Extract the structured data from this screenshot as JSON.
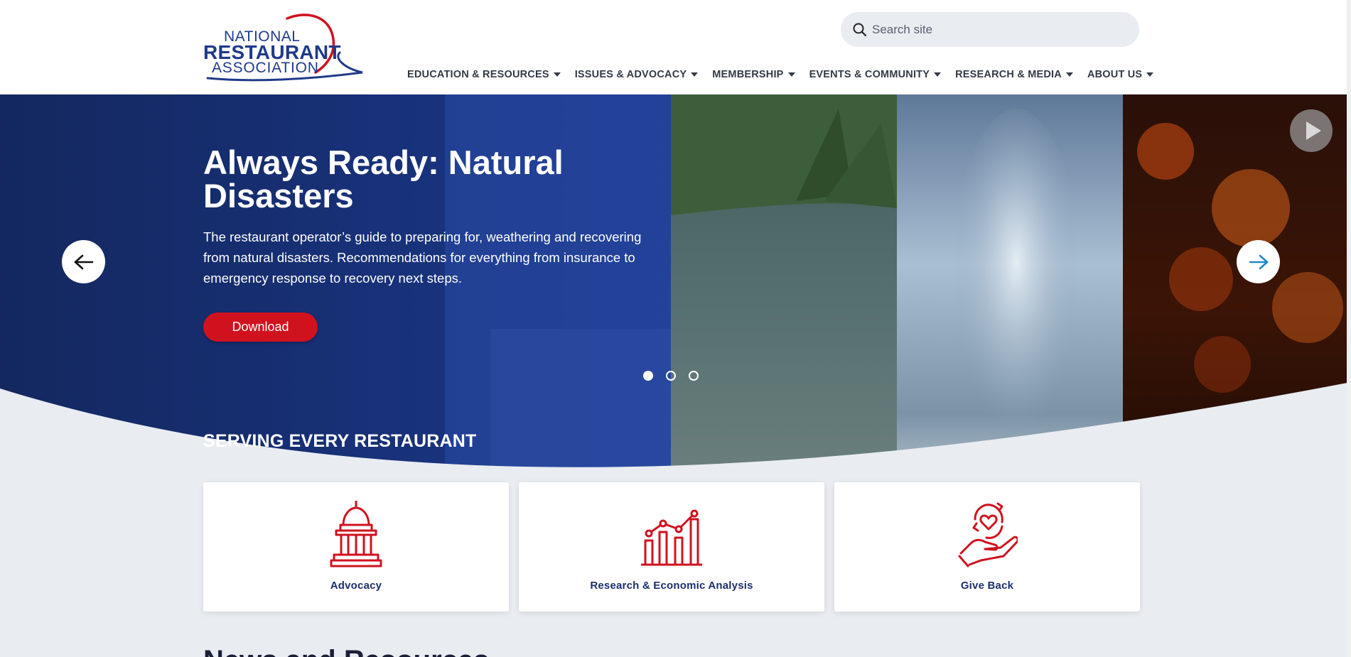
{
  "header": {
    "logo": {
      "line1": "NATIONAL",
      "line2": "RESTAURANT",
      "line3": "ASSOCIATION",
      "color": "#1f3a8a",
      "accent": "#d0121f"
    },
    "search": {
      "placeholder": "Search site",
      "value": ""
    },
    "nav": [
      {
        "label": "EDUCATION & RESOURCES"
      },
      {
        "label": "ISSUES & ADVOCACY"
      },
      {
        "label": "MEMBERSHIP"
      },
      {
        "label": "EVENTS & COMMUNITY"
      },
      {
        "label": "RESEARCH & MEDIA"
      },
      {
        "label": "ABOUT US"
      }
    ]
  },
  "hero": {
    "title": "Always Ready: Natural Disasters",
    "description": "The restaurant operator’s guide to preparing for, weathering and recovering from natural disasters. Recommendations for everything from insurance to emergency response to recovery next steps.",
    "button_label": "Download",
    "slide_count": 3,
    "active_slide": 1,
    "colors": {
      "overlay": "#1a3a8f",
      "button": "#d0121f"
    }
  },
  "serving": {
    "title": "SERVING EVERY RESTAURANT",
    "cards": [
      {
        "label": "Advocacy",
        "icon": "capitol-icon"
      },
      {
        "label": "Research & Economic Analysis",
        "icon": "bar-chart-icon"
      },
      {
        "label": "Give Back",
        "icon": "heart-hand-icon"
      }
    ]
  },
  "next_section_peek": "News and Resources"
}
